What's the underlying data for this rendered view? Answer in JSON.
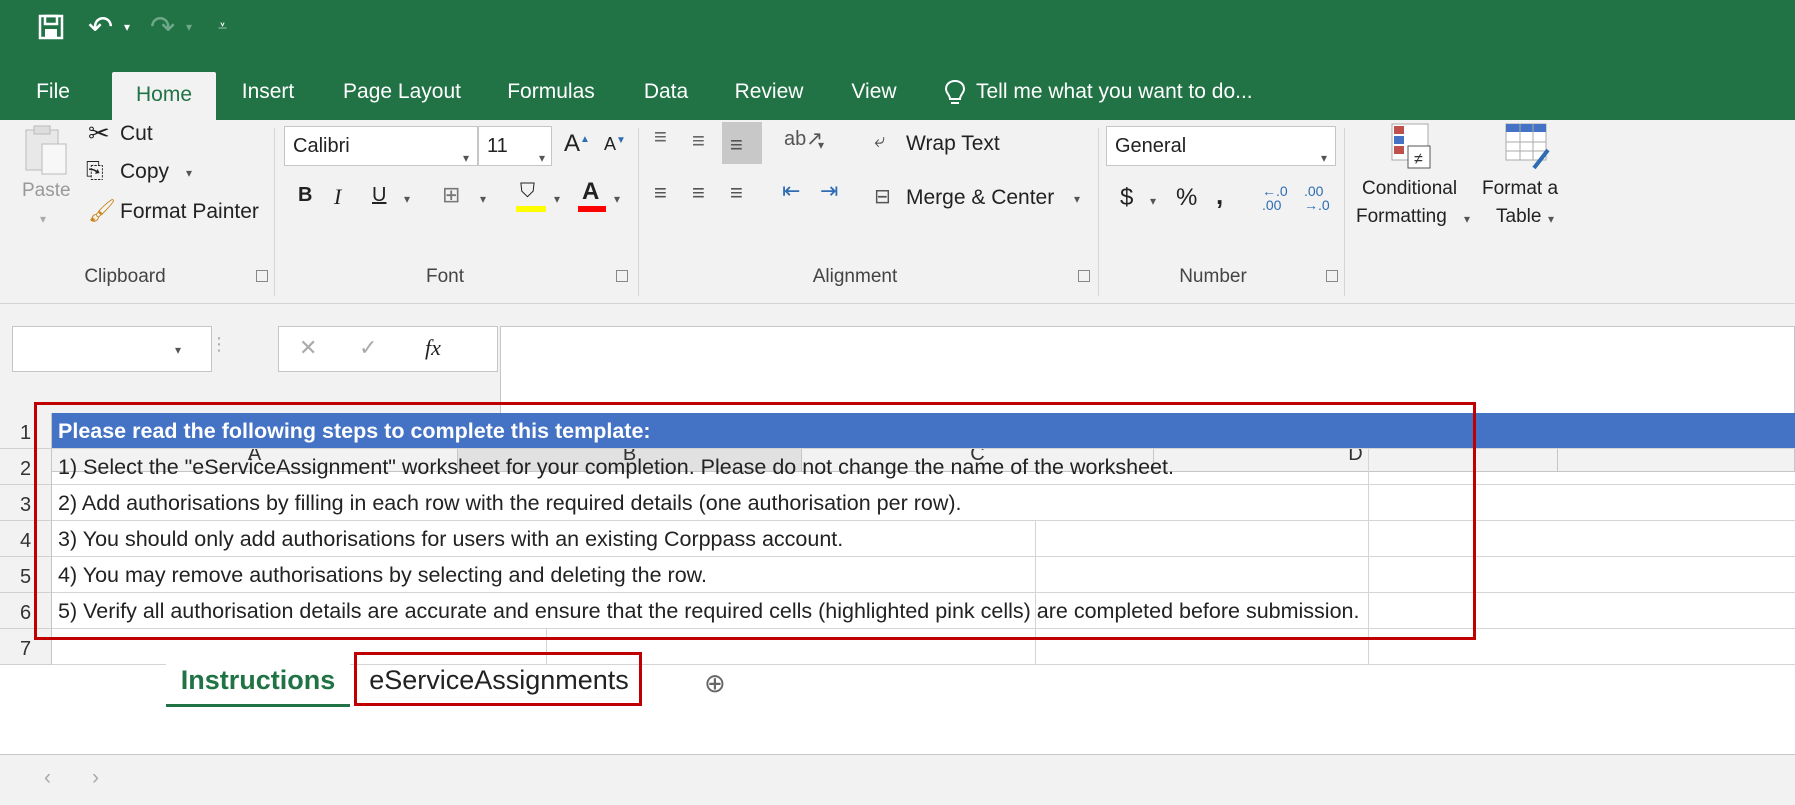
{
  "quick_access": {
    "save_icon": "save-icon",
    "undo_icon": "undo-icon",
    "redo_icon": "redo-icon",
    "customize_icon": "customize-qat-icon"
  },
  "tabs": [
    "File",
    "Home",
    "Insert",
    "Page Layout",
    "Formulas",
    "Data",
    "Review",
    "View"
  ],
  "tell_me": "Tell me what you want to do...",
  "clipboard": {
    "paste": "Paste",
    "cut": "Cut",
    "copy": "Copy",
    "format_painter": "Format Painter",
    "group": "Clipboard"
  },
  "font": {
    "name": "Calibri",
    "size": "11",
    "bold": "B",
    "italic": "I",
    "underline": "U",
    "group": "Font",
    "highlight_color": "#ffff00",
    "font_color": "#ff0000"
  },
  "alignment": {
    "wrap_text": "Wrap Text",
    "merge_center": "Merge & Center",
    "group": "Alignment"
  },
  "number": {
    "format": "General",
    "currency": "$",
    "percent": "%",
    "comma": ",",
    "group": "Number"
  },
  "styles": {
    "conditional_formatting": [
      "Conditional",
      "Formatting"
    ],
    "format_as_table": [
      "Format a",
      "Table"
    ]
  },
  "formula_bar": {
    "name_box": "",
    "cancel": "✕",
    "enter": "✓",
    "fx": "fx",
    "content": ""
  },
  "columns": [
    "A",
    "B",
    "C",
    "D"
  ],
  "rows": [
    {
      "num": "1",
      "text": "Please read the following steps to complete this template:"
    },
    {
      "num": "2",
      "text": "1) Select the \"eServiceAssignment\" worksheet for your completion. Please do not change the name of the worksheet."
    },
    {
      "num": "3",
      "text": "2) Add authorisations by filling in each row with the required details (one authorisation per row)."
    },
    {
      "num": "4",
      "text": "3) You should only add authorisations for users with an existing Corppass account."
    },
    {
      "num": "5",
      "text": "4) You may remove authorisations by selecting and deleting the row."
    },
    {
      "num": "6",
      "text": "5) Verify all authorisation details are accurate and ensure that the required cells (highlighted pink cells) are completed before submission."
    },
    {
      "num": "7",
      "text": ""
    }
  ],
  "sheets": [
    "Instructions",
    "eServiceAssignments"
  ],
  "colors": {
    "excel_green": "#217346",
    "header_blue": "#4472c4",
    "highlight_red": "#c00000"
  }
}
